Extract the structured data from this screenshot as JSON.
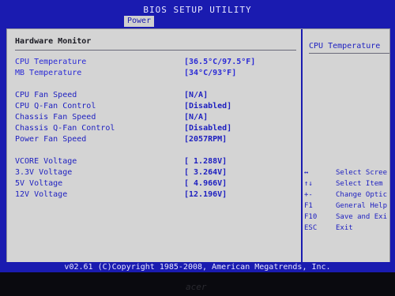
{
  "header": {
    "title": "BIOS SETUP UTILITY",
    "active_tab": "Power"
  },
  "left_panel": {
    "title": "Hardware Monitor",
    "groups": [
      {
        "items": [
          {
            "label": "CPU Temperature",
            "value": "[36.5°C/97.5°F]"
          },
          {
            "label": "MB Temperature",
            "value": "[34°C/93°F]"
          }
        ]
      },
      {
        "items": [
          {
            "label": "CPU Fan Speed",
            "value": "[N/A]"
          },
          {
            "label": "CPU Q-Fan Control",
            "value": "[Disabled]"
          },
          {
            "label": "Chassis Fan Speed",
            "value": "[N/A]"
          },
          {
            "label": "Chassis Q-Fan Control",
            "value": "[Disabled]"
          },
          {
            "label": "Power Fan Speed",
            "value": "[2057RPM]"
          }
        ]
      },
      {
        "items": [
          {
            "label": "VCORE  Voltage",
            "value": "[ 1.288V]"
          },
          {
            "label": "3.3V  Voltage",
            "value": "[ 3.264V]"
          },
          {
            "label": "5V  Voltage",
            "value": "[ 4.966V]"
          },
          {
            "label": "12V  Voltage",
            "value": "[12.196V]"
          }
        ]
      }
    ]
  },
  "right_panel": {
    "title": "CPU Temperature",
    "keys": [
      {
        "key": "↔",
        "desc": "Select Scree"
      },
      {
        "key": "↑↓",
        "desc": "Select Item"
      },
      {
        "key": "+-",
        "desc": "Change Optic"
      },
      {
        "key": "F1",
        "desc": "General Help"
      },
      {
        "key": "F10",
        "desc": "Save and Exi"
      },
      {
        "key": "ESC",
        "desc": "Exit"
      }
    ]
  },
  "footer": {
    "text": "v02.61 (C)Copyright 1985-2008, American Megatrends, Inc."
  },
  "bezel": {
    "brand": "acer"
  },
  "colors": {
    "bios_blue": "#1a1bb0",
    "panel_gray": "#d4d4d4",
    "text_blue": "#1d1fc0"
  }
}
